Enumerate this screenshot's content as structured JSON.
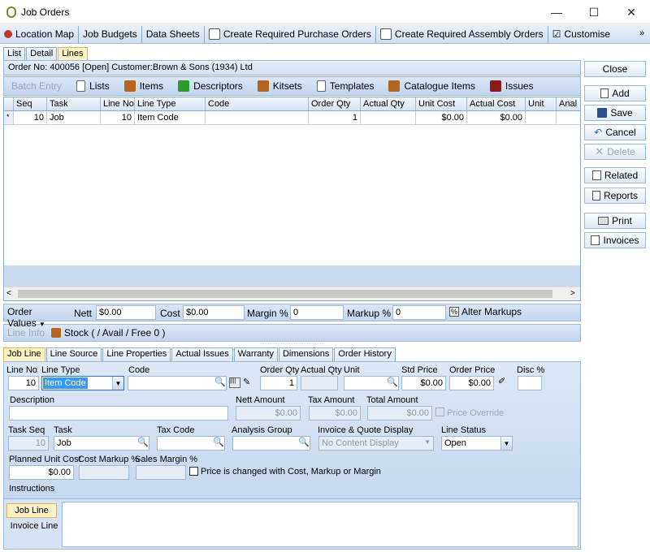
{
  "window": {
    "title": "Job Orders"
  },
  "toolbar": [
    {
      "label": "Location Map",
      "icon": "map-pin-icon"
    },
    {
      "label": "Job Budgets",
      "icon": ""
    },
    {
      "label": "Data Sheets",
      "icon": ""
    },
    {
      "label": "Create Required Purchase Orders",
      "icon": "create-po-icon"
    },
    {
      "label": "Create Required Assembly Orders",
      "icon": "create-ao-icon"
    },
    {
      "label": "Customise",
      "icon": "checkbox-icon"
    }
  ],
  "tabs": [
    "List",
    "Detail",
    "Lines"
  ],
  "order_header": "Order No: 400056 [Open] Customer:Brown & Sons (1934) Ltd",
  "subtoolbar": {
    "batch": "Batch Entry",
    "items": [
      "Lists",
      "Items",
      "Descriptors",
      "Kitsets",
      "Templates",
      "Catalogue Items",
      "Issues"
    ]
  },
  "grid": {
    "columns": [
      "Seq",
      "Task",
      "Line No",
      "Line Type",
      "Code",
      "Order Qty",
      "Actual Qty",
      "Unit Cost",
      "Actual Cost",
      "Unit",
      "Anal"
    ],
    "rows": [
      [
        "10",
        "Job",
        "10",
        "Item Code",
        "",
        "1",
        "",
        "$0.00",
        "$0.00",
        "",
        ""
      ]
    ]
  },
  "totals": {
    "order_values": "Order Values",
    "nett_label": "Nett",
    "nett": "$0.00",
    "cost_label": "Cost",
    "cost": "$0.00",
    "margin_label": "Margin %",
    "margin": "0",
    "markup_label": "Markup %",
    "markup": "0",
    "alter": "Alter Markups"
  },
  "lineinfo": {
    "label": "Line Info",
    "stock": "Stock ( / Avail / Free 0 )"
  },
  "line_tabs": [
    "Job Line",
    "Line Source",
    "Line Properties",
    "Actual Issues",
    "Warranty",
    "Dimensions",
    "Order History"
  ],
  "form": {
    "line_no_label": "Line No",
    "line_no": "10",
    "line_type_label": "Line Type",
    "line_type": "Item Code",
    "code_label": "Code",
    "code": "",
    "order_qty_label": "Order Qty",
    "order_qty": "1",
    "actual_qty_label": "Actual Qty",
    "actual_qty": "",
    "unit_label": "Unit",
    "unit": "",
    "std_price_label": "Std Price",
    "std_price": "$0.00",
    "order_price_label": "Order Price",
    "order_price": "$0.00",
    "disc_label": "Disc %",
    "disc": "",
    "description_label": "Description",
    "description": "",
    "nett_amount_label": "Nett Amount",
    "nett_amount": "$0.00",
    "tax_amount_label": "Tax Amount",
    "tax_amount": "$0.00",
    "total_amount_label": "Total Amount",
    "total_amount": "$0.00",
    "price_override": "Price Override",
    "task_seq_label": "Task Seq",
    "task_seq": "10",
    "task_label": "Task",
    "task": "Job",
    "tax_code_label": "Tax Code",
    "tax_code": "",
    "analysis_group_label": "Analysis Group",
    "analysis_group": "",
    "invoice_display_label": "Invoice & Quote Display",
    "invoice_display": "No Content Display",
    "line_status_label": "Line Status",
    "line_status": "Open",
    "planned_unit_cost_label": "Planned Unit Cost",
    "planned_unit_cost": "$0.00",
    "cost_markup_label": "Cost Markup %",
    "cost_markup": "",
    "sales_margin_label": "Sales Margin %",
    "sales_margin": "",
    "price_changed": "Price is changed with Cost, Markup or Margin",
    "instructions_label": "Instructions"
  },
  "instr_tabs": [
    "Job Line",
    "Invoice Line"
  ],
  "buttons": {
    "close": "Close",
    "add": "Add",
    "save": "Save",
    "cancel": "Cancel",
    "delete": "Delete",
    "related": "Related",
    "reports": "Reports",
    "print": "Print",
    "invoices": "Invoices"
  }
}
